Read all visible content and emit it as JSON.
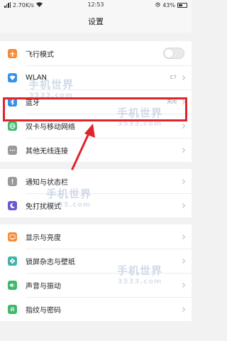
{
  "status": {
    "left_text": "2.70K/s",
    "time": "12:53",
    "battery": "43%"
  },
  "header": {
    "title": "设置"
  },
  "groups": [
    [
      {
        "label": "飞行模式",
        "icon": "airplane-icon",
        "color": "#f78a34",
        "control": "toggle"
      },
      {
        "label": "WLAN",
        "icon": "wifi-icon",
        "color": "#3a8fe8",
        "value": "C7",
        "control": "chevron"
      },
      {
        "label": "蓝牙",
        "icon": "bluetooth-icon",
        "color": "#3a8fe8",
        "value": "关闭",
        "control": "chevron"
      },
      {
        "label": "双卡与移动网络",
        "icon": "globe-icon",
        "color": "#41b86b",
        "control": "chevron"
      },
      {
        "label": "其他无线连接",
        "icon": "more-icon",
        "color": "#9a9a9a",
        "control": "chevron"
      }
    ],
    [
      {
        "label": "通知与状态栏",
        "icon": "notification-icon",
        "color": "#9a9a9a",
        "control": "chevron"
      },
      {
        "label": "免打扰模式",
        "icon": "moon-icon",
        "color": "#6a57d6",
        "control": "chevron"
      }
    ],
    [
      {
        "label": "显示与亮度",
        "icon": "display-icon",
        "color": "#f78a34",
        "control": "chevron"
      },
      {
        "label": "锁屏杂志与壁纸",
        "icon": "flower-icon",
        "color": "#3fb3a8",
        "control": "chevron"
      },
      {
        "label": "声音与振动",
        "icon": "sound-icon",
        "color": "#3fb86a",
        "control": "chevron"
      },
      {
        "label": "指纹与密码",
        "icon": "fingerprint-icon",
        "color": "#41b86b",
        "control": "chevron"
      }
    ]
  ],
  "watermark": {
    "title": "手机世界",
    "sub": "3533.com"
  },
  "annotation": {
    "color": "#e0242b"
  }
}
